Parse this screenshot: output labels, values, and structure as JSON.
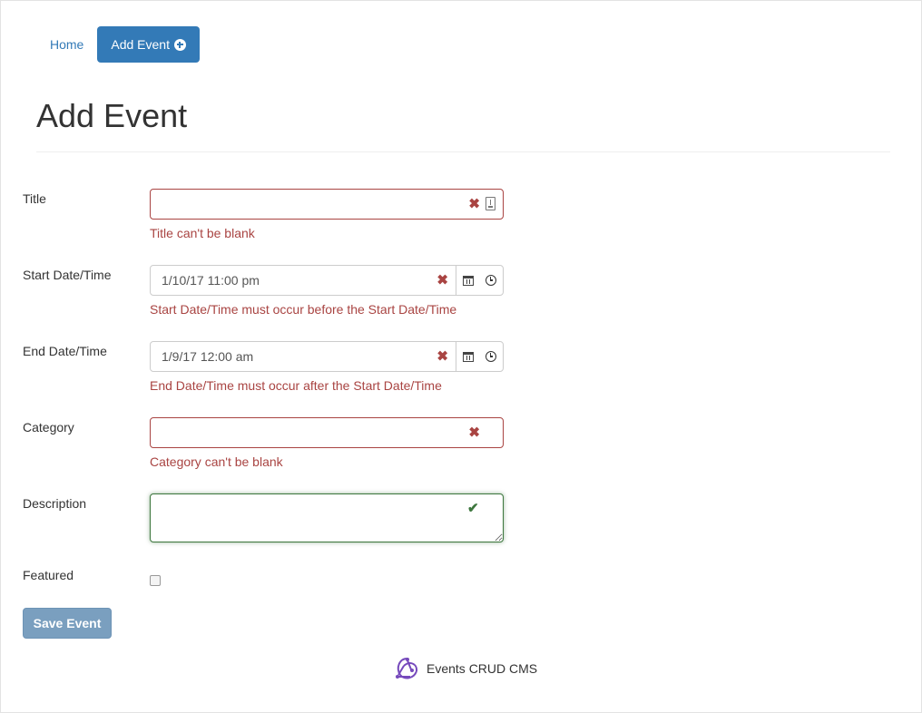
{
  "nav": {
    "home_label": "Home",
    "add_event_label": "Add Event"
  },
  "page": {
    "title": "Add Event"
  },
  "form": {
    "title": {
      "label": "Title",
      "value": "",
      "error": "Title can't be blank"
    },
    "start": {
      "label": "Start Date/Time",
      "value": "1/10/17 11:00 pm",
      "error": "Start Date/Time must occur before the Start Date/Time"
    },
    "end": {
      "label": "End Date/Time",
      "value": "1/9/17 12:00 am",
      "error": "End Date/Time must occur after the Start Date/Time"
    },
    "category": {
      "label": "Category",
      "value": "",
      "error": "Category can't be blank"
    },
    "description": {
      "label": "Description",
      "value": ""
    },
    "featured": {
      "label": "Featured",
      "checked": false
    },
    "save_label": "Save Event"
  },
  "footer": {
    "text": "Events CRUD CMS",
    "logo_icon": "redux-logo-icon"
  },
  "colors": {
    "primary": "#337ab7",
    "error": "#a94442",
    "success": "#3c763d",
    "save_button": "#7a9fbf",
    "logo": "#764abc"
  }
}
